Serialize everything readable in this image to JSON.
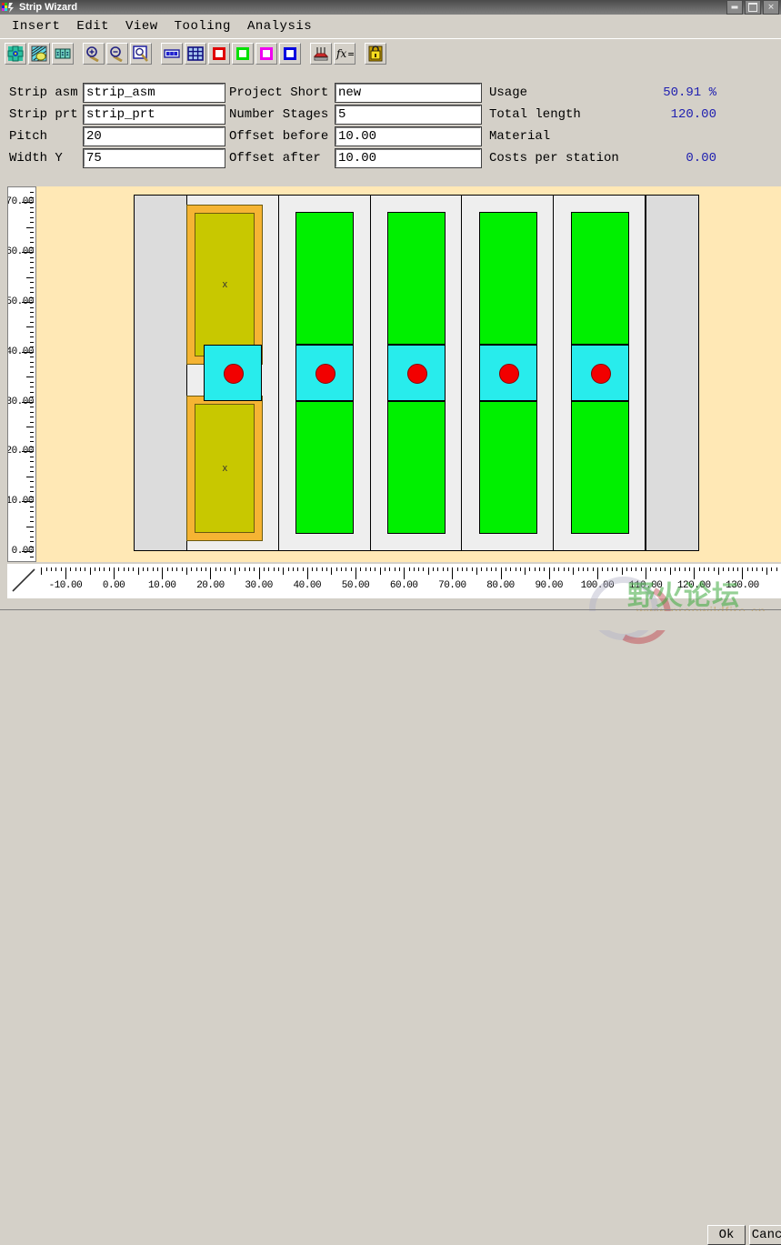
{
  "window": {
    "title": "Strip Wizard",
    "icon": "app-icon",
    "controls": {
      "minimize": "minimize",
      "maximize": "maximize",
      "close": "close"
    }
  },
  "menu": {
    "items": [
      {
        "label": "Insert",
        "name": "menu-insert"
      },
      {
        "label": "Edit",
        "name": "menu-edit"
      },
      {
        "label": "View",
        "name": "menu-view"
      },
      {
        "label": "Tooling",
        "name": "menu-tooling"
      },
      {
        "label": "Analysis",
        "name": "menu-analysis"
      }
    ]
  },
  "toolbar": {
    "groups": [
      {
        "buttons": [
          {
            "name": "new-strip-icon",
            "kind": "strip-new"
          },
          {
            "name": "strip-layout-icon",
            "kind": "strip-hatch"
          },
          {
            "name": "station-grid-icon",
            "kind": "station-grid"
          }
        ]
      },
      {
        "buttons": [
          {
            "name": "zoom-in-icon",
            "kind": "zoom-in"
          },
          {
            "name": "zoom-out-icon",
            "kind": "zoom-out"
          },
          {
            "name": "zoom-fit-icon",
            "kind": "zoom-fit"
          }
        ]
      },
      {
        "buttons": [
          {
            "name": "strip-view-icon",
            "kind": "bar-view"
          },
          {
            "name": "table-view-icon",
            "kind": "table-view"
          },
          {
            "name": "red-square-icon",
            "kind": "square",
            "color": "#e00000"
          },
          {
            "name": "green-square-icon",
            "kind": "square",
            "color": "#00e000"
          },
          {
            "name": "magenta-square-icon",
            "kind": "square",
            "color": "#f000f0"
          },
          {
            "name": "blue-square-icon",
            "kind": "square",
            "color": "#0000e0"
          }
        ]
      },
      {
        "buttons": [
          {
            "name": "measure-icon",
            "kind": "measure"
          },
          {
            "name": "function-icon",
            "kind": "fx"
          }
        ]
      },
      {
        "buttons": [
          {
            "name": "lock-icon",
            "kind": "lock"
          }
        ]
      }
    ]
  },
  "params": {
    "left": [
      {
        "label": "Strip asm",
        "value": "strip_asm",
        "name": "strip-asm"
      },
      {
        "label": "Strip prt",
        "value": "strip_prt",
        "name": "strip-prt"
      },
      {
        "label": "Pitch",
        "value": "20",
        "name": "pitch"
      },
      {
        "label": "Width Y",
        "value": "75",
        "name": "width-y"
      }
    ],
    "middle": [
      {
        "label": "Project Short",
        "value": "new",
        "name": "project-short"
      },
      {
        "label": "Number Stages",
        "value": "5",
        "name": "number-stages"
      },
      {
        "label": "Offset before",
        "value": "10.00",
        "name": "offset-before"
      },
      {
        "label": "Offset after",
        "value": "10.00",
        "name": "offset-after"
      }
    ],
    "right": [
      {
        "label": "Usage",
        "value": "50.91 %",
        "name": "usage"
      },
      {
        "label": "Total length",
        "value": "120.00",
        "name": "total-length"
      },
      {
        "label": "Material",
        "value": "",
        "name": "material"
      },
      {
        "label": "Costs per station",
        "value": "0.00",
        "name": "costs-per-station"
      }
    ],
    "value_color": "#2020b0"
  },
  "rulers": {
    "vertical": {
      "labels": [
        "70.00",
        "60.00",
        "50.00",
        "40.00",
        "30.00",
        "20.00",
        "10.00",
        "0.00"
      ],
      "values": [
        70,
        60,
        50,
        40,
        30,
        20,
        10,
        0
      ],
      "min": -2,
      "max": 73
    },
    "horizontal": {
      "labels": [
        "-10.00",
        "0.00",
        "10.00",
        "20.00",
        "30.00",
        "40.00",
        "50.00",
        "60.00",
        "70.00",
        "80.00",
        "90.00",
        "100.00",
        "110.00",
        "120.00",
        "130.00"
      ],
      "values": [
        -10,
        0,
        10,
        20,
        30,
        40,
        50,
        60,
        70,
        80,
        90,
        100,
        110,
        120,
        130
      ],
      "min": -16,
      "max": 138
    }
  },
  "canvas": {
    "background": "#ffe8b5",
    "strip_background": "#eeeeee",
    "stations": [
      {
        "name": "station-1",
        "type": "yellow",
        "index": 1
      },
      {
        "name": "station-2",
        "type": "green",
        "index": 2
      },
      {
        "name": "station-3",
        "type": "green",
        "index": 3
      },
      {
        "name": "station-4",
        "type": "green",
        "index": 4
      },
      {
        "name": "station-5",
        "type": "green",
        "index": 5
      }
    ],
    "marks": [
      "x",
      "x"
    ],
    "colors": {
      "green_part": "#00f000",
      "cyan_box": "#28ecec",
      "red_dot": "#f20000",
      "yellow_outer": "#f5b433",
      "yellow_inner": "#c8c800",
      "end_cap": "#dcdcdc"
    }
  },
  "watermark": {
    "text_cn": "野火论坛",
    "text_url": "www.proewildfire.cn"
  },
  "dialog_buttons": [
    {
      "label": "Ok",
      "name": "ok-button"
    },
    {
      "label": "Cancel",
      "name": "cancel-button"
    }
  ]
}
